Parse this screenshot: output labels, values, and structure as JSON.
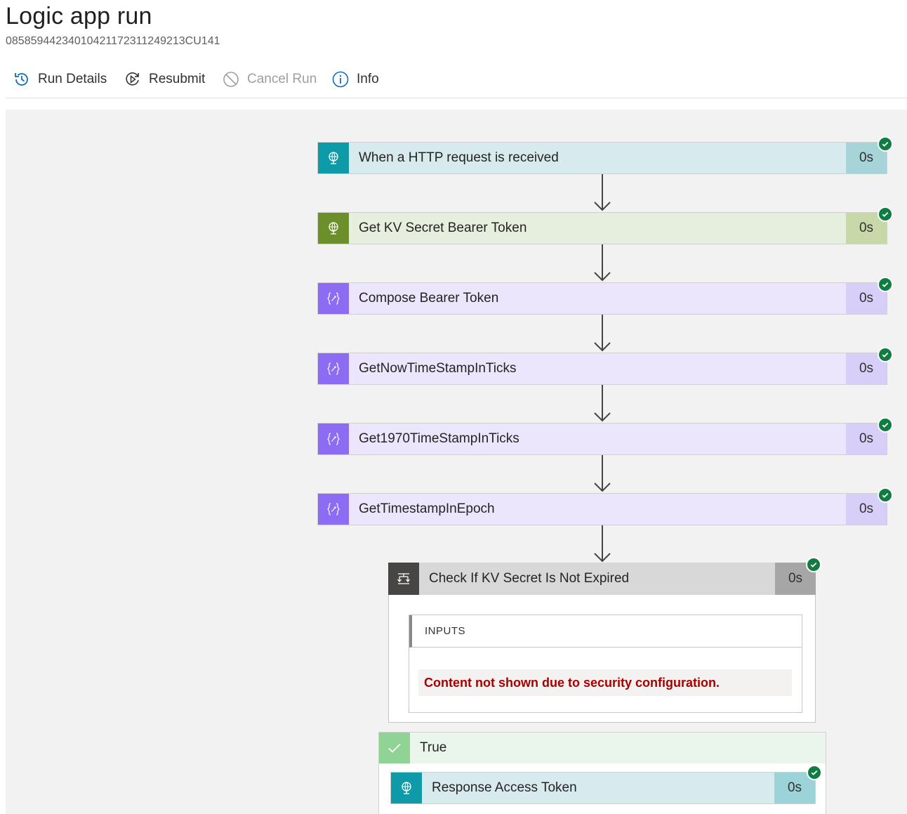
{
  "header": {
    "title": "Logic app run",
    "run_id": "08585944234010421172311249213CU141"
  },
  "toolbar": {
    "run_details": "Run Details",
    "resubmit": "Resubmit",
    "cancel_run": "Cancel Run",
    "info": "Info"
  },
  "colors": {
    "http_icon": "#0e9aa7",
    "http_bar": "#d7eaee",
    "http_dur": "#a7d4d9",
    "kv_icon": "#6c8f2b",
    "kv_bar": "#e6eedd",
    "kv_dur": "#c8d8a9",
    "compose_icon": "#8c6cf2",
    "compose_bar": "#ebe6fb",
    "compose_dur": "#d8cff8",
    "cond_icon": "#484644",
    "cond_bar": "#d8d8d8",
    "cond_dur": "#a6a6a6",
    "resp_icon": "#0e9aa7",
    "resp_bar": "#d7eaee",
    "resp_dur": "#9bd3d8",
    "success": "#107c41",
    "error_text": "#a80000"
  },
  "steps": [
    {
      "label": "When a HTTP request is received",
      "duration": "0s",
      "icon": "http-globe-icon"
    },
    {
      "label": "Get KV Secret Bearer Token",
      "duration": "0s",
      "icon": "keyvault-globe-icon"
    },
    {
      "label": "Compose Bearer Token",
      "duration": "0s",
      "icon": "compose-braces-icon"
    },
    {
      "label": "GetNowTimeStampInTicks",
      "duration": "0s",
      "icon": "compose-braces-icon"
    },
    {
      "label": "Get1970TimeStampInTicks",
      "duration": "0s",
      "icon": "compose-braces-icon"
    },
    {
      "label": "GetTimestampInEpoch",
      "duration": "0s",
      "icon": "compose-braces-icon"
    }
  ],
  "condition": {
    "label": "Check If KV Secret Is Not Expired",
    "duration": "0s",
    "inputs_label": "INPUTS",
    "security_message": "Content not shown due to security configuration."
  },
  "true_branch": {
    "label": "True",
    "action": {
      "label": "Response Access Token",
      "duration": "0s"
    }
  }
}
